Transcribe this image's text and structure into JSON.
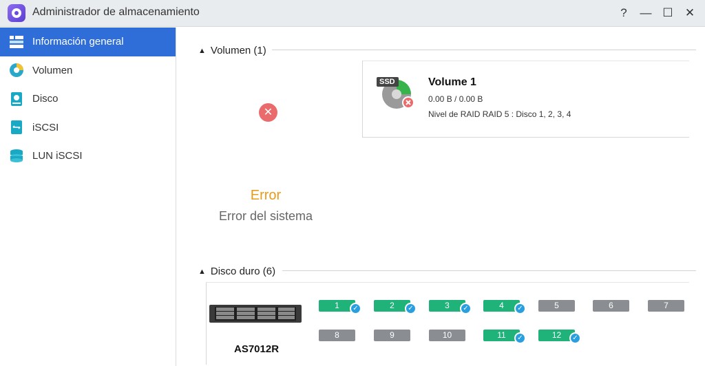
{
  "window": {
    "title": "Administrador de almacenamiento",
    "controls": {
      "help": "?",
      "minimize": "—",
      "maximize": "☐",
      "close": "✕"
    }
  },
  "sidebar": {
    "items": [
      {
        "label": "Información general",
        "icon": "overview-icon",
        "active": true
      },
      {
        "label": "Volumen",
        "icon": "volume-icon"
      },
      {
        "label": "Disco",
        "icon": "disk-icon"
      },
      {
        "label": "iSCSI",
        "icon": "iscsi-icon"
      },
      {
        "label": "LUN iSCSI",
        "icon": "lun-icon"
      }
    ]
  },
  "volumes": {
    "header": "Volumen (1)",
    "card": {
      "badge": "SSD",
      "name": "Volume 1",
      "size": "0.00 B / 0.00 B",
      "raid": "Nivel de RAID RAID 5 : Disco 1, 2, 3, 4"
    },
    "status": {
      "title": "Error",
      "description": "Error del sistema"
    }
  },
  "disks": {
    "header": "Disco duro (6)",
    "device": "AS7012R",
    "slots": [
      {
        "label": "1",
        "state": "ok"
      },
      {
        "label": "2",
        "state": "ok"
      },
      {
        "label": "3",
        "state": "ok"
      },
      {
        "label": "4",
        "state": "ok"
      },
      {
        "label": "5",
        "state": "empty"
      },
      {
        "label": "6",
        "state": "empty"
      },
      {
        "label": "7",
        "state": "empty"
      },
      {
        "label": "8",
        "state": "empty"
      },
      {
        "label": "9",
        "state": "empty"
      },
      {
        "label": "10",
        "state": "empty"
      },
      {
        "label": "11",
        "state": "ok"
      },
      {
        "label": "12",
        "state": "ok"
      }
    ]
  },
  "colors": {
    "accent": "#2f6ed8",
    "disk_ok": "#1fb37a",
    "disk_empty": "#8a8d91",
    "error": "#e89a1a",
    "error_icon": "#ea6b6b"
  }
}
